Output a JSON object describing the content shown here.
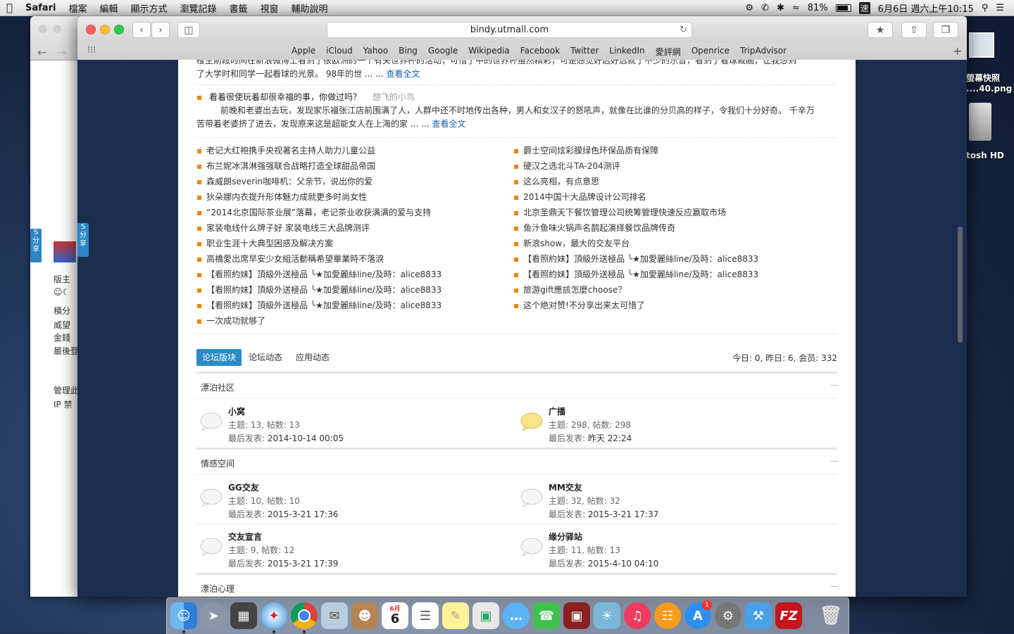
{
  "menubar": {
    "apple": "",
    "app": "Safari",
    "menus": [
      "檔案",
      "編輯",
      "顯示方式",
      "瀏覽記錄",
      "書籤",
      "視窗",
      "輔助說明"
    ],
    "battery": "81%",
    "input_method": "速",
    "clock": "6月6日 週六上午10:15"
  },
  "desktop": {
    "label1_line1": "螢幕快照",
    "label1_line2": "....40.png",
    "label2": "tosh HD"
  },
  "browser": {
    "url": "bindy.utmall.com",
    "favorites": [
      "Apple",
      "iCloud",
      "Yahoo",
      "Bing",
      "Google",
      "Wikipedia",
      "Facebook",
      "Twitter",
      "LinkedIn",
      "愛評網",
      "Openrice",
      "TripAdvisor"
    ]
  },
  "backwin": {
    "items": [
      "版主",
      "積分",
      "威望",
      "金錢",
      "最後登",
      "管理此",
      "IP  禁"
    ]
  },
  "share_label": "分享",
  "article1": {
    "line1": "  楼主前段时间在新浪微博上看到了很欧洲的一个有关世界杯的活动，可惜了中的世界杯虽然精彩，可是感觉好远好远就了不少的乐音，看到了看球裁画，让我想到",
    "line2": "了大学时和同学一起看球的光景。         98年的世 ... ...",
    "more": "查看全文"
  },
  "article2": {
    "title": "看着很使玩着却很幸福的事，你做过吗？",
    "author": "想飞的小鸟",
    "line1": "前晚和老婆出去玩，发现家乐福张江店前围满了人，人群中还不时地传出各种，男人和女汉子的怒吼声，就像在比谁的分贝高的样子，令我们十分好奇。       千辛万",
    "line2": "苦带着老婆挤了进去，发现原来这是超能女人在上海的家 ... ...",
    "more": "查看全文"
  },
  "links_left": [
    "老记大红袍携手央视著名主持人助力儿童公益",
    "布兰妮冰淇淋强强联合战略打造全球甜品帝国",
    "森威朗severin咖啡机：父亲节，说出你的爱",
    "狄朵娜内衣提升形体魅力成就更多时尚女性",
    "“2014北京国际茶业展”落幕，老记茶业收获满满的爱与支持",
    "家装电线什么牌子好 家装电线三大品牌测评",
    "职业生涯十大典型困惑及解决方案",
    "高橋愛出席早安少女組活動稱希望畢業時不落淚",
    "【看照約妹】頂級外送極品 ╰★加愛麗絲line/及時：alice8833",
    "【看照約妹】頂級外送極品 ╰★加愛麗絲line/及時：alice8833",
    "【看照約妹】頂級外送極品 ╰★加愛麗絲line/及時：alice8833",
    "一次成功就够了"
  ],
  "links_right": [
    "爵士空间炫彩膜绿色环保品质有保障",
    "硬汉之选北斗TA-204测评",
    "这么亮相，有点意思",
    "2014中国十大品牌设计公司排名",
    "北京圣鼎天下餐饮管理公司统筹管理快速反应赢取市场",
    "鱼汁鱼味火锅声名鹊起演绎餐饮品牌传奇",
    "新浪show，最大的交友平台",
    "【看照約妹】頂級外送極品 ╰★加愛麗絲line/及時：alice8833",
    "【看照約妹】頂級外送極品 ╰★加愛麗絲line/及時：alice8833",
    "旅游gift應該怎麼choose？",
    "这个绝对赞!不分享出来太可惜了"
  ],
  "tabs": [
    "论坛版块",
    "论坛动态",
    "应用动态"
  ],
  "stats": "今日: 0, 昨日: 6, 会员: 332",
  "collapse_symbol": "—",
  "sections": [
    {
      "title": "漂泊社区",
      "forums": [
        {
          "name": "小窝",
          "stat": "主题: 13, 帖数: 13",
          "last_label": "最后发表: ",
          "last": "2014-10-14 00:05",
          "color": "#f5f5f5"
        },
        {
          "name": "广播",
          "stat": "主题: 298, 帖数: 298",
          "last_label": "最后发表: ",
          "last": "昨天 22:24",
          "color": "#f7e48a"
        }
      ]
    },
    {
      "title": "情感空间",
      "forums": [
        {
          "name": "GG交友",
          "stat": "主题: 10, 帖数: 10",
          "last_label": "最后发表: ",
          "last": "2015-3-21 17:36",
          "color": "#f5f5f5"
        },
        {
          "name": "MM交友",
          "stat": "主题: 32, 帖数: 32",
          "last_label": "最后发表: ",
          "last": "2015-3-21 17:37",
          "color": "#f5f5f5"
        },
        {
          "name": "交友宣言",
          "stat": "主题: 9, 帖数: 12",
          "last_label": "最后发表: ",
          "last": "2015-3-21 17:39",
          "color": "#f5f5f5"
        },
        {
          "name": "缘分驿站",
          "stat": "主题: 11, 帖数: 13",
          "last_label": "最后发表: ",
          "last": "2015-4-10 04:10",
          "color": "#f5f5f5"
        }
      ]
    },
    {
      "title": "漂泊心理",
      "forums": []
    }
  ],
  "dock": {
    "calendar_month": "6月",
    "calendar_day": "6",
    "appstore_badge": "1",
    "filezilla": "FZ"
  }
}
